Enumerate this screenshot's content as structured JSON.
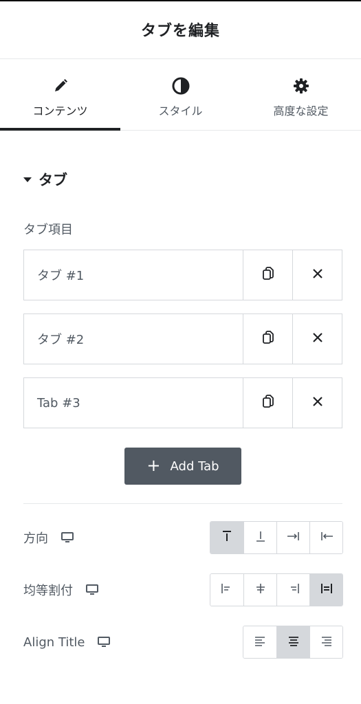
{
  "header": {
    "title": "タブを編集"
  },
  "tabs": [
    {
      "label": "コンテンツ",
      "icon": "pencil-icon",
      "active": true
    },
    {
      "label": "スタイル",
      "icon": "half-circle-icon",
      "active": false
    },
    {
      "label": "高度な設定",
      "icon": "gear-icon",
      "active": false
    }
  ],
  "section": {
    "title": "タブ"
  },
  "tab_items": {
    "label": "タブ項目",
    "items": [
      {
        "title": "タブ #1"
      },
      {
        "title": "タブ #2"
      },
      {
        "title": "Tab #3"
      }
    ],
    "add_label": "Add Tab"
  },
  "controls": {
    "direction": {
      "label": "方向",
      "options": [
        "top",
        "bottom",
        "end",
        "start"
      ],
      "selected": "top"
    },
    "justify": {
      "label": "均等割付",
      "options": [
        "start",
        "center",
        "end",
        "stretch"
      ],
      "selected": "stretch"
    },
    "align_title": {
      "label": "Align Title",
      "options": [
        "left",
        "center",
        "right"
      ],
      "selected": "center"
    }
  },
  "colors": {
    "text_dark": "#1f2124",
    "text_muted": "#515962",
    "border": "#d5d8dc",
    "button_bg": "#515962",
    "selected_bg": "#d5d8dc"
  }
}
